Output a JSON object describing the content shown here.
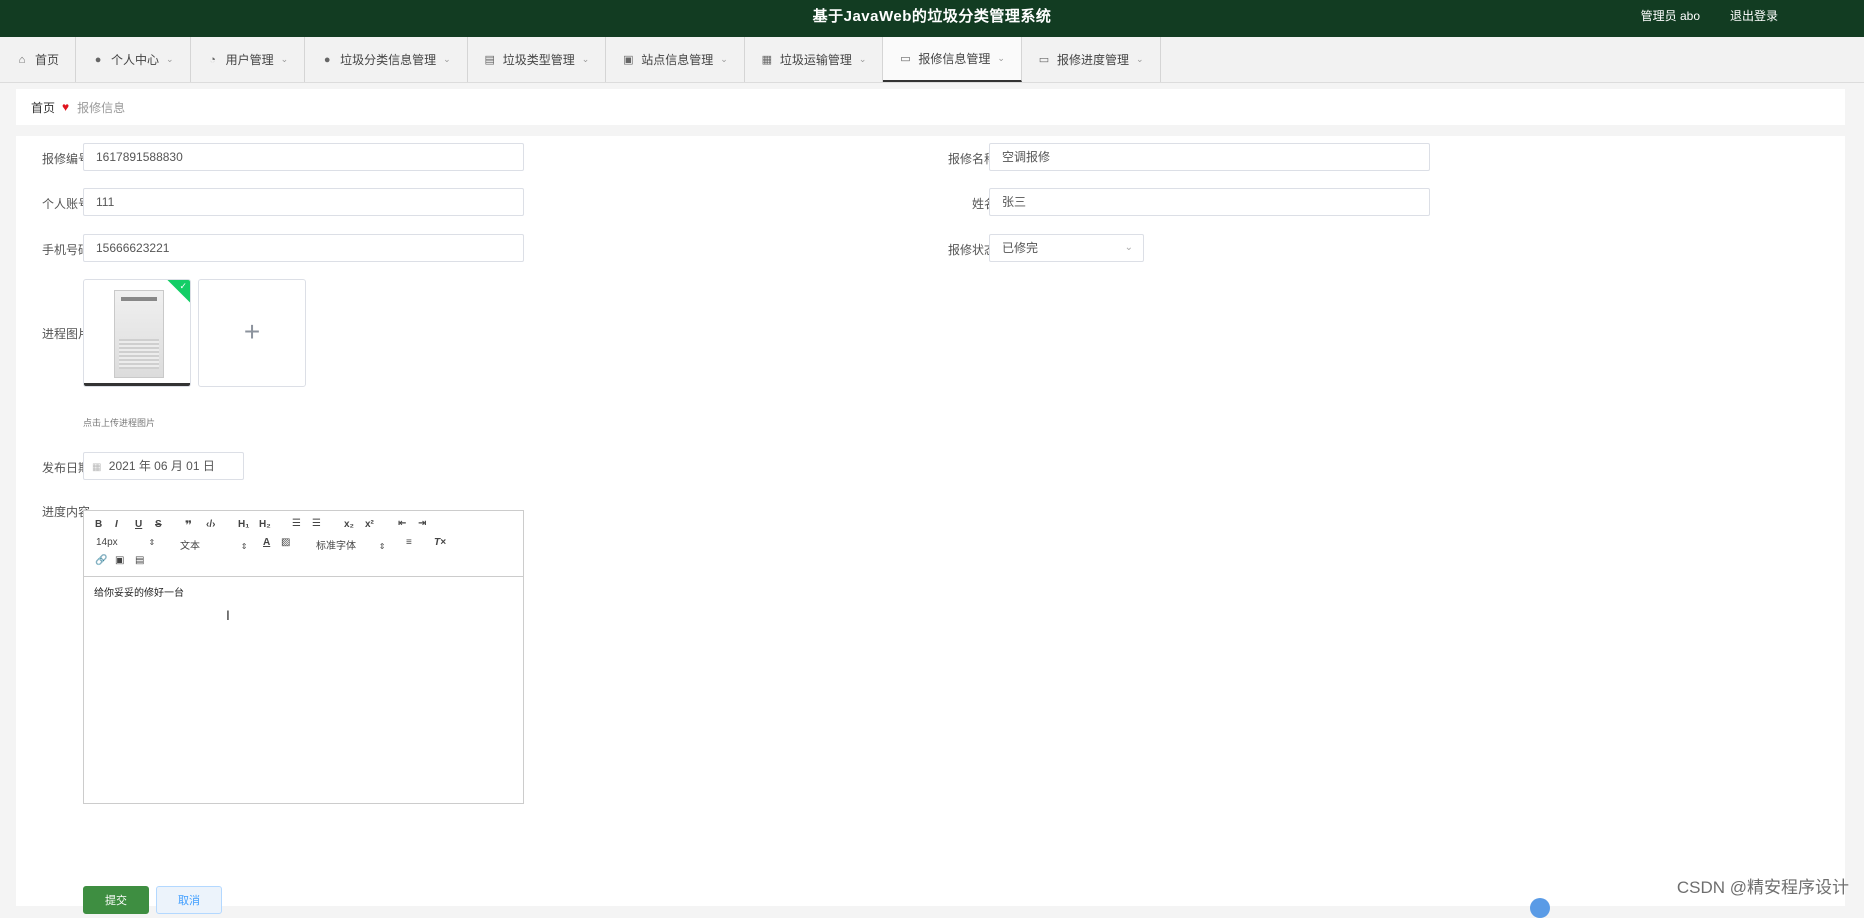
{
  "header": {
    "title": "基于JavaWeb的垃圾分类管理系统",
    "user": "管理员 abo",
    "logout": "退出登录"
  },
  "nav": [
    {
      "label": "首页",
      "icon": "home-icon",
      "has_dropdown": false
    },
    {
      "label": "个人中心",
      "icon": "user-icon",
      "has_dropdown": true
    },
    {
      "label": "用户管理",
      "icon": "dashboard-icon",
      "has_dropdown": true
    },
    {
      "label": "垃圾分类信息管理",
      "icon": "user-icon",
      "has_dropdown": true
    },
    {
      "label": "垃圾类型管理",
      "icon": "chart-icon",
      "has_dropdown": true
    },
    {
      "label": "站点信息管理",
      "icon": "clipboard-icon",
      "has_dropdown": true
    },
    {
      "label": "垃圾运输管理",
      "icon": "grid-icon",
      "has_dropdown": true
    },
    {
      "label": "报修信息管理",
      "icon": "monitor-icon",
      "has_dropdown": true,
      "active": true
    },
    {
      "label": "报修进度管理",
      "icon": "id-card-icon",
      "has_dropdown": true
    }
  ],
  "breadcrumb": {
    "home": "首页",
    "current": "报修信息"
  },
  "form": {
    "repair_no_label": "报修编号",
    "repair_no": "1617891588830",
    "repair_name_label": "报修名称",
    "repair_name": "空调报修",
    "account_label": "个人账号",
    "account": "111",
    "name_label": "姓名",
    "name": "张三",
    "phone_label": "手机号码",
    "phone": "15666623221",
    "status_label": "报修状态",
    "status": "已修完",
    "image_label": "进程图片",
    "upload_hint": "点击上传进程图片",
    "date_label": "发布日期",
    "date": "2021 年 06 月 01 日",
    "content_label": "进度内容",
    "content_text": "给你妥妥的修好一台",
    "submit": "提交",
    "cancel": "取消"
  },
  "editor": {
    "font_size": "14px",
    "text_style": "文本",
    "font_family": "标准字体"
  },
  "watermark": "CSDN @精安程序设计"
}
